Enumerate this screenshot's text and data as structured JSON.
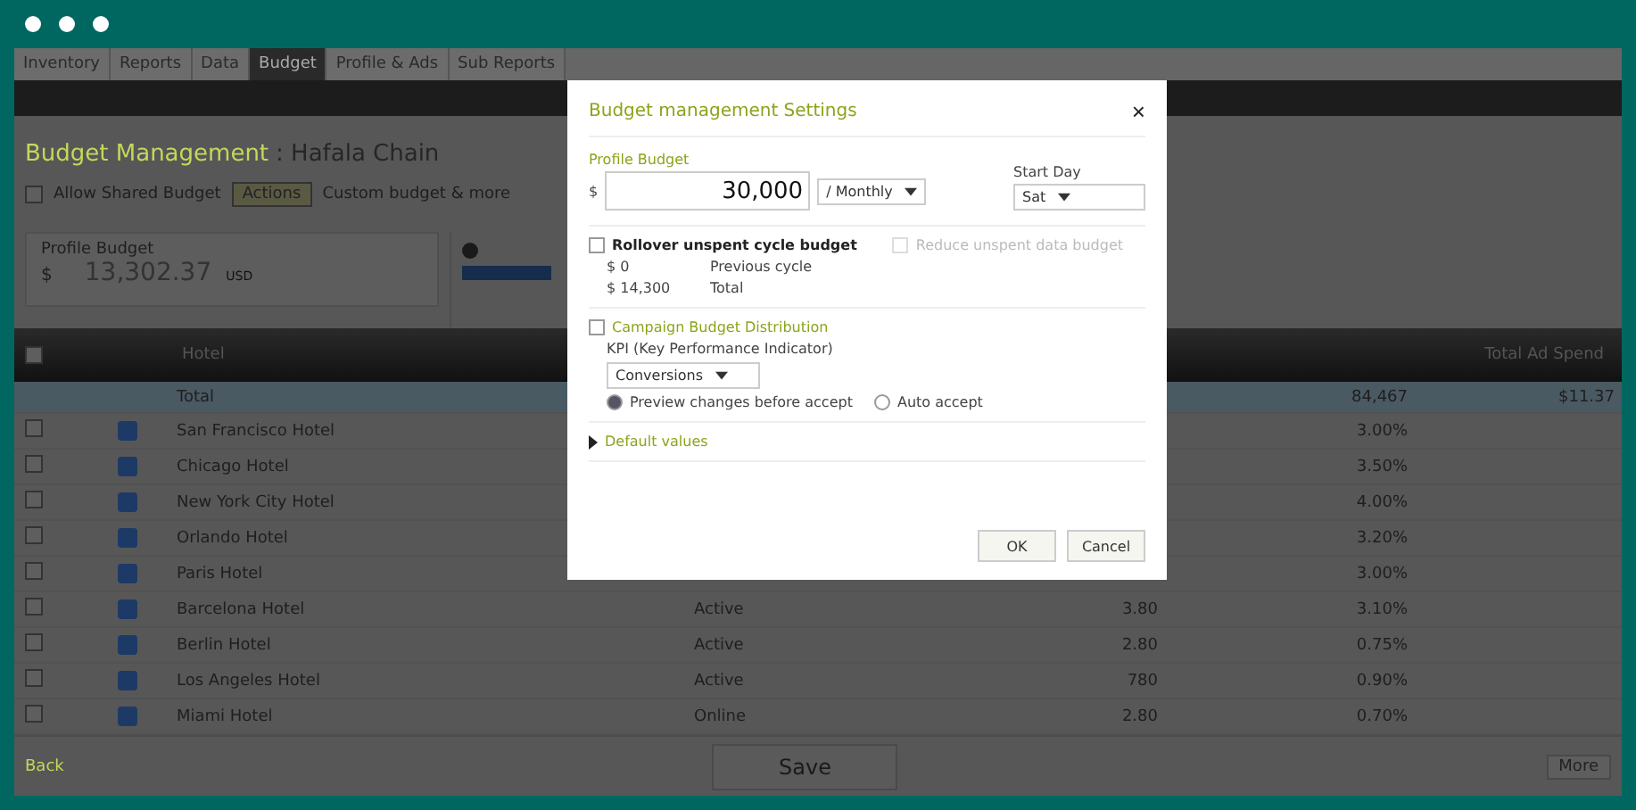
{
  "tabs": [
    {
      "label": "Inventory",
      "selected": false
    },
    {
      "label": "Reports",
      "selected": false
    },
    {
      "label": "Data",
      "selected": false
    },
    {
      "label": "Budget",
      "selected": true
    },
    {
      "label": "Profile & Ads",
      "selected": false
    },
    {
      "label": "Sub Reports",
      "selected": false
    }
  ],
  "heading": {
    "title": "Budget Management",
    "subtitle": ": Hafala Chain"
  },
  "toolbar": {
    "shared_budget": {
      "label": "Allow Shared Budget",
      "checked": false
    },
    "action_button": "Actions",
    "note": "Custom budget & more"
  },
  "profile_panel": {
    "label": "Profile Budget",
    "currency": "$",
    "amount": "13,302.37",
    "unit": "USD"
  },
  "table": {
    "select_all": false,
    "header_label": "Hotel",
    "right_header": "Total Ad Spend",
    "total": {
      "name": "Total",
      "spend": "84,467",
      "rate": "$11.37"
    },
    "rows": [
      {
        "name": "San Francisco Hotel",
        "checked": false,
        "spend": "3.00%"
      },
      {
        "name": "Chicago Hotel",
        "checked": false,
        "spend": "3.50%"
      },
      {
        "name": "New York City Hotel",
        "checked": false,
        "spend": "4.00%"
      },
      {
        "name": "Orlando Hotel",
        "checked": false,
        "spend": "3.20%"
      },
      {
        "name": "Paris Hotel",
        "checked": false,
        "spend": "3.00%"
      },
      {
        "name": "Barcelona Hotel",
        "checked": false,
        "status": "Active",
        "value": "3.80",
        "spend": "3.10%"
      },
      {
        "name": "Berlin Hotel",
        "checked": false,
        "status": "Active",
        "value": "2.80",
        "spend": "0.75%"
      },
      {
        "name": "Los Angeles Hotel",
        "checked": false,
        "status": "Active",
        "value": "780",
        "spend": "0.90%"
      },
      {
        "name": "Miami Hotel",
        "checked": false,
        "status": "Online",
        "value": "2.80",
        "spend": "0.70%"
      }
    ]
  },
  "footer": {
    "left": "Back",
    "save": "Save",
    "right": "More"
  },
  "dialog": {
    "title": "Budget management Settings",
    "close": "×",
    "budget_label": "Profile Budget",
    "currency": "$",
    "amount": "30,000",
    "period": "/ Monthly",
    "start_label": "Start Day",
    "start_value": "Sat",
    "rollover": {
      "label": "Rollover unspent cycle budget",
      "checked": false
    },
    "reduce": {
      "label": "Reduce unspent data budget",
      "checked": false,
      "disabled": true
    },
    "cycle_rows": [
      {
        "amount": "$ 0",
        "label": "Previous cycle"
      },
      {
        "amount": "$ 14,300",
        "label": "Total"
      }
    ],
    "distribution": {
      "label": "Campaign Budget Distribution",
      "checked": false
    },
    "kpi_label": "KPI (Key Performance Indicator)",
    "kpi_value": "Conversions",
    "modes": [
      {
        "label": "Preview changes before accept",
        "selected": true
      },
      {
        "label": "Auto accept",
        "selected": false
      }
    ],
    "defaults": "Default values",
    "ok": "OK",
    "cancel": "Cancel"
  }
}
